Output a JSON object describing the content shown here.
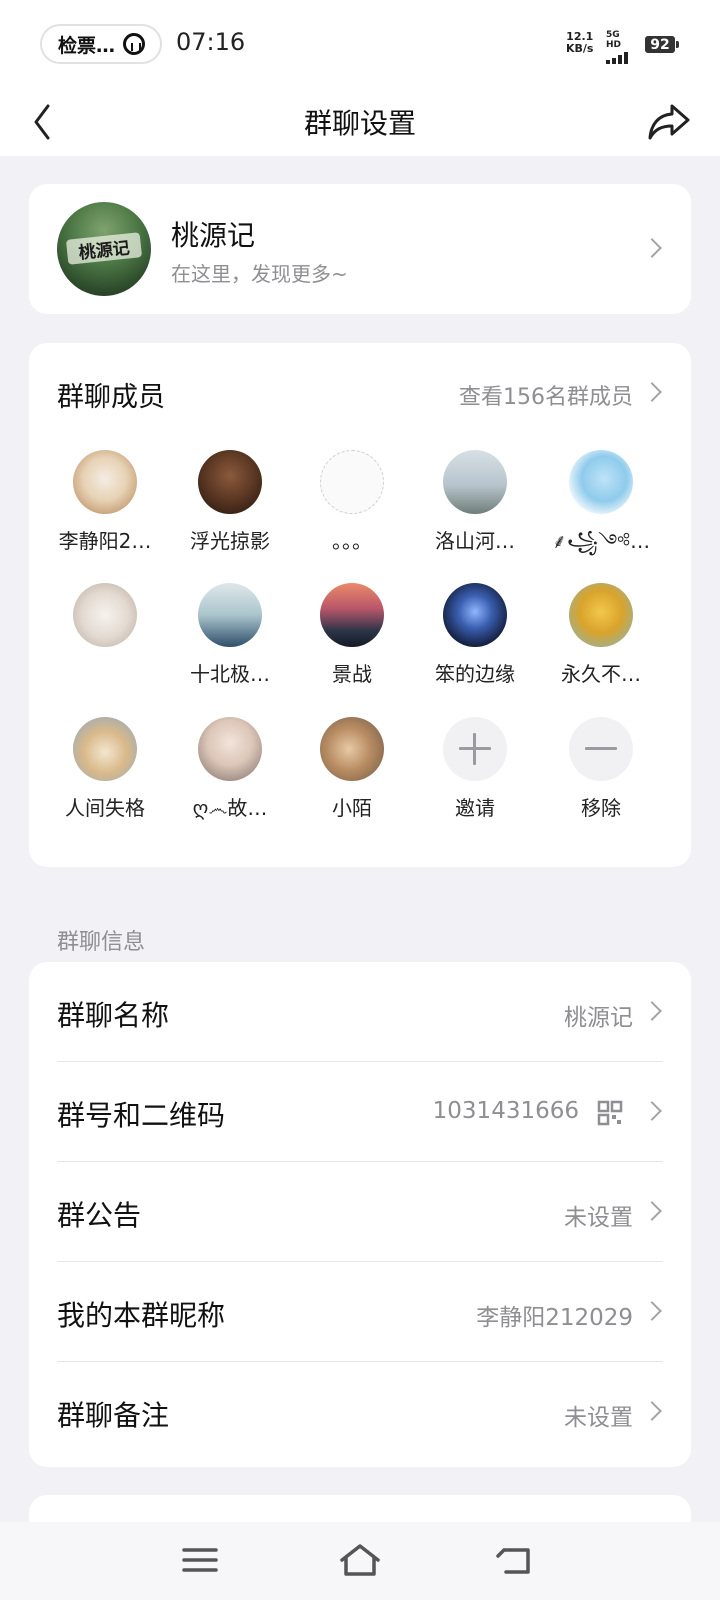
{
  "status_bar": {
    "pill_text": "检票…",
    "time": "07:16",
    "net_speed_value": "12.1",
    "net_speed_unit": "KB/s",
    "network_label": "5G HD",
    "battery": "92"
  },
  "nav": {
    "title": "群聊设置"
  },
  "group": {
    "avatar_text": "桃源记",
    "name": "桃源记",
    "description": "在这里，发现更多~"
  },
  "members": {
    "title": "群聊成员",
    "view_all": "查看156名群成员",
    "list": [
      {
        "name": "李静阳2…",
        "avatar": "cat-kitten"
      },
      {
        "name": "浮光掠影",
        "avatar": "smiling-man"
      },
      {
        "name": "。。。",
        "avatar": "sketch"
      },
      {
        "name": "洛山河…",
        "avatar": "misty-silhouette"
      },
      {
        "name": "⸙꧁༺…",
        "avatar": "cartoon-blob"
      },
      {
        "name": "",
        "avatar": "white-cat"
      },
      {
        "name": "十北极…",
        "avatar": "sea-figure"
      },
      {
        "name": "景战",
        "avatar": "sunset-figure"
      },
      {
        "name": "笨的边缘",
        "avatar": "galaxy"
      },
      {
        "name": "永久不…",
        "avatar": "yellow-dog"
      },
      {
        "name": "人间失格",
        "avatar": "shiba-dog"
      },
      {
        "name": "ღ෴故…",
        "avatar": "boy-headphones"
      },
      {
        "name": "小陌",
        "avatar": "sleeping-cat"
      }
    ],
    "invite_label": "邀请",
    "remove_label": "移除"
  },
  "info": {
    "section_label": "群聊信息",
    "rows": [
      {
        "label": "群聊名称",
        "value": "桃源记"
      },
      {
        "label": "群号和二维码",
        "value": "1031431666"
      },
      {
        "label": "群公告",
        "value": "未设置"
      },
      {
        "label": "我的本群昵称",
        "value": "李静阳212029"
      },
      {
        "label": "群聊备注",
        "value": "未设置"
      }
    ]
  },
  "colors": {
    "background": "#f2f2f6",
    "card": "#ffffff",
    "secondary_text": "#8e8e93"
  }
}
